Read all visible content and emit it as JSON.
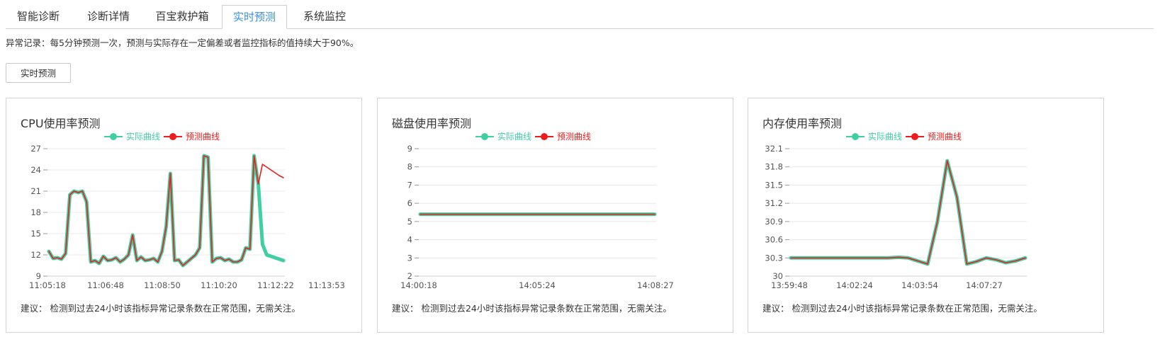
{
  "tabs": [
    {
      "label": "智能诊断",
      "active": false
    },
    {
      "label": "诊断详情",
      "active": false
    },
    {
      "label": "百宝救护箱",
      "active": false
    },
    {
      "label": "实时预测",
      "active": true
    },
    {
      "label": "系统监控",
      "active": false
    }
  ],
  "notice": "异常记录：每5分钟预测一次，预测与实际存在一定偏差或者监控指标的值持续大于90%。",
  "predict_button": "实时预测",
  "colors": {
    "actual": "#3fcfa3",
    "predicted": "#ee1c1c",
    "active_tab": "#3a8ee6",
    "grid": "#e8e8e8"
  },
  "charts": [
    {
      "title": "CPU使用率预测",
      "suggestion": "建议： 检测到过去24小时该指标异常记录条数在正常范围，无需关注。",
      "legend": {
        "actual": "实际曲线",
        "predicted": "预测曲线"
      }
    },
    {
      "title": "磁盘使用率预测",
      "suggestion": "建议： 检测到过去24小时该指标异常记录条数在正常范围，无需关注。",
      "legend": {
        "actual": "实际曲线",
        "predicted": "预测曲线"
      }
    },
    {
      "title": "内存使用率预测",
      "suggestion": "建议： 检测到过去24小时该指标异常记录条数在正常范围，无需关注。",
      "legend": {
        "actual": "实际曲线",
        "predicted": "预测曲线"
      }
    }
  ],
  "chart_data": [
    {
      "type": "line",
      "title": "CPU使用率预测",
      "y_ticks": [
        "27",
        "24",
        "21",
        "18",
        "15",
        "12",
        "9"
      ],
      "ylim": [
        9,
        27
      ],
      "x_ticks": [
        "11:05:18",
        "11:06:48",
        "11:08:50",
        "11:10:20",
        "11:12:22",
        "11:13:53"
      ],
      "series": [
        {
          "name": "实际曲线",
          "color": "#3fcfa3",
          "values": [
            12.5,
            11.5,
            11.6,
            11.4,
            12.2,
            20.5,
            21.0,
            20.8,
            21.0,
            19.5,
            11.0,
            11.2,
            10.8,
            11.8,
            11.2,
            11.3,
            11.6,
            11.0,
            11.4,
            12.0,
            14.8,
            11.2,
            11.7,
            11.2,
            11.3,
            11.5,
            11.0,
            12.5,
            16.0,
            23.5,
            11.2,
            11.3,
            10.5,
            11.0,
            11.5,
            12.0,
            13.0,
            26.0,
            25.8,
            11.0,
            11.5,
            11.6,
            11.2,
            11.4,
            11.0,
            11.0,
            11.3,
            13.0,
            12.8,
            26.0,
            22.0,
            13.5,
            12.0,
            11.8,
            11.6,
            11.4,
            11.2
          ]
        },
        {
          "name": "预测曲线",
          "color": "#ee1c1c",
          "values": [
            12.5,
            11.5,
            11.6,
            11.4,
            12.2,
            20.5,
            21.0,
            20.8,
            21.0,
            19.5,
            11.0,
            11.2,
            10.8,
            11.8,
            11.2,
            11.3,
            11.6,
            11.0,
            11.4,
            12.0,
            14.8,
            11.2,
            11.7,
            11.2,
            11.3,
            11.5,
            11.0,
            12.5,
            16.0,
            23.5,
            11.2,
            11.3,
            10.5,
            11.0,
            11.5,
            12.0,
            13.0,
            26.0,
            25.8,
            11.0,
            11.5,
            11.6,
            11.2,
            11.4,
            11.0,
            11.0,
            11.3,
            13.0,
            12.8,
            26.0,
            22.0,
            24.8,
            24.4,
            24.0,
            23.6,
            23.2,
            22.9
          ]
        }
      ]
    },
    {
      "type": "line",
      "title": "磁盘使用率预测",
      "y_ticks": [
        "9",
        "8",
        "7",
        "6",
        "5",
        "4",
        "3",
        "2"
      ],
      "ylim": [
        2,
        9
      ],
      "x_ticks": [
        "14:00:18",
        "14:05:24",
        "14:08:27"
      ],
      "series": [
        {
          "name": "实际曲线",
          "color": "#3fcfa3",
          "values": [
            5.4,
            5.4,
            5.4,
            5.4,
            5.4,
            5.4,
            5.4,
            5.4,
            5.4,
            5.4
          ]
        },
        {
          "name": "预测曲线",
          "color": "#ee1c1c",
          "values": [
            5.4,
            5.4,
            5.4,
            5.4,
            5.4,
            5.4,
            5.4,
            5.4,
            5.4,
            5.4
          ]
        }
      ]
    },
    {
      "type": "line",
      "title": "内存使用率预测",
      "y_ticks": [
        "32.1",
        "31.8",
        "31.5",
        "31.2",
        "30.9",
        "30.6",
        "30.3",
        "30"
      ],
      "ylim": [
        30,
        32.1
      ],
      "x_ticks": [
        "13:59:48",
        "14:02:24",
        "14:03:54",
        "14:07:27"
      ],
      "series": [
        {
          "name": "实际曲线",
          "color": "#3fcfa3",
          "values": [
            30.3,
            30.3,
            30.3,
            30.3,
            30.3,
            30.3,
            30.3,
            30.3,
            30.3,
            30.3,
            30.3,
            30.31,
            30.3,
            30.25,
            30.2,
            30.9,
            31.9,
            31.3,
            30.2,
            30.24,
            30.3,
            30.27,
            30.22,
            30.25,
            30.3
          ]
        },
        {
          "name": "预测曲线",
          "color": "#ee1c1c",
          "values": [
            30.3,
            30.3,
            30.3,
            30.3,
            30.3,
            30.3,
            30.3,
            30.3,
            30.3,
            30.3,
            30.3,
            30.31,
            30.3,
            30.25,
            30.2,
            30.9,
            31.9,
            31.3,
            30.2,
            30.24,
            30.3,
            30.27,
            30.22,
            30.25,
            30.3
          ]
        }
      ]
    }
  ]
}
